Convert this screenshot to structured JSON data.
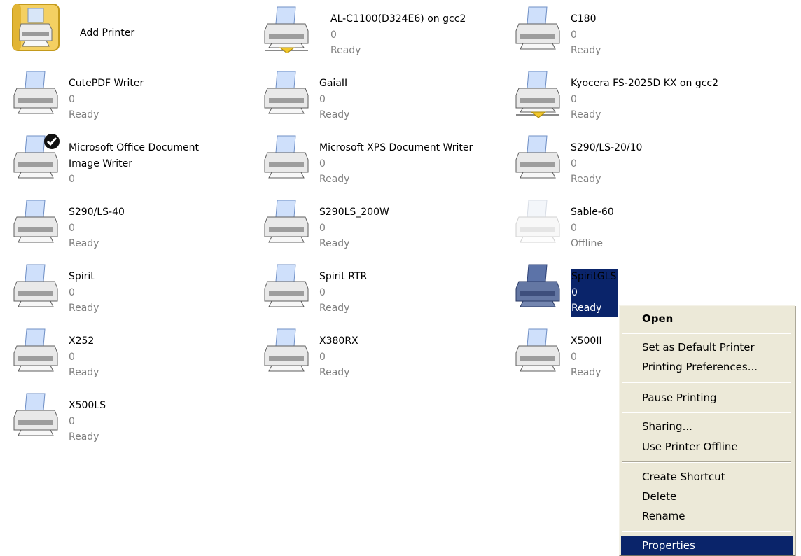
{
  "printers": [
    {
      "name": "Add Printer",
      "count": "",
      "status": "",
      "kind": "add"
    },
    {
      "name": "AL-C1100(D324E6) on gcc2",
      "count": "0",
      "status": "Ready",
      "kind": "network"
    },
    {
      "name": "C180",
      "count": "0",
      "status": "Ready",
      "kind": "printer"
    },
    {
      "name": "CutePDF Writer",
      "count": "0",
      "status": "Ready",
      "kind": "printer"
    },
    {
      "name": "GaiaII",
      "count": "0",
      "status": "Ready",
      "kind": "printer"
    },
    {
      "name": "Kyocera FS-2025D KX on gcc2",
      "count": "0",
      "status": "Ready",
      "kind": "network"
    },
    {
      "name": "Microsoft Office Document Image Writer",
      "count": "0",
      "status": "",
      "kind": "default"
    },
    {
      "name": "Microsoft XPS Document Writer",
      "count": "0",
      "status": "Ready",
      "kind": "printer"
    },
    {
      "name": "S290/LS-20/10",
      "count": "0",
      "status": "Ready",
      "kind": "printer"
    },
    {
      "name": "S290/LS-40",
      "count": "0",
      "status": "Ready",
      "kind": "printer"
    },
    {
      "name": "S290LS_200W",
      "count": "0",
      "status": "Ready",
      "kind": "printer"
    },
    {
      "name": "Sable-60",
      "count": "0",
      "status": "Offline",
      "kind": "offline"
    },
    {
      "name": "Spirit",
      "count": "0",
      "status": "Ready",
      "kind": "printer"
    },
    {
      "name": "Spirit RTR",
      "count": "0",
      "status": "Ready",
      "kind": "printer"
    },
    {
      "name": "SpiritGLS",
      "count": "0",
      "status": "Ready",
      "kind": "selected"
    },
    {
      "name": "X252",
      "count": "0",
      "status": "Ready",
      "kind": "printer"
    },
    {
      "name": "X380RX",
      "count": "0",
      "status": "Ready",
      "kind": "printer"
    },
    {
      "name": "X500II",
      "count": "0",
      "status": "Ready",
      "kind": "printer"
    },
    {
      "name": "X500LS",
      "count": "0",
      "status": "Ready",
      "kind": "printer"
    }
  ],
  "context_menu": {
    "items": [
      {
        "label": "Open",
        "bold": true,
        "group": 0
      },
      {
        "label": "Set as Default Printer",
        "group": 1
      },
      {
        "label": "Printing Preferences...",
        "group": 1
      },
      {
        "label": "Pause Printing",
        "group": 2
      },
      {
        "label": "Sharing...",
        "group": 3
      },
      {
        "label": "Use Printer Offline",
        "group": 3
      },
      {
        "label": "Create Shortcut",
        "group": 4
      },
      {
        "label": "Delete",
        "group": 4
      },
      {
        "label": "Rename",
        "group": 4
      },
      {
        "label": "Properties",
        "group": 5,
        "highlighted": true
      }
    ]
  },
  "colors": {
    "selection": "#0a246a",
    "menu_bg": "#ece9d8",
    "status_gray": "#808080"
  }
}
